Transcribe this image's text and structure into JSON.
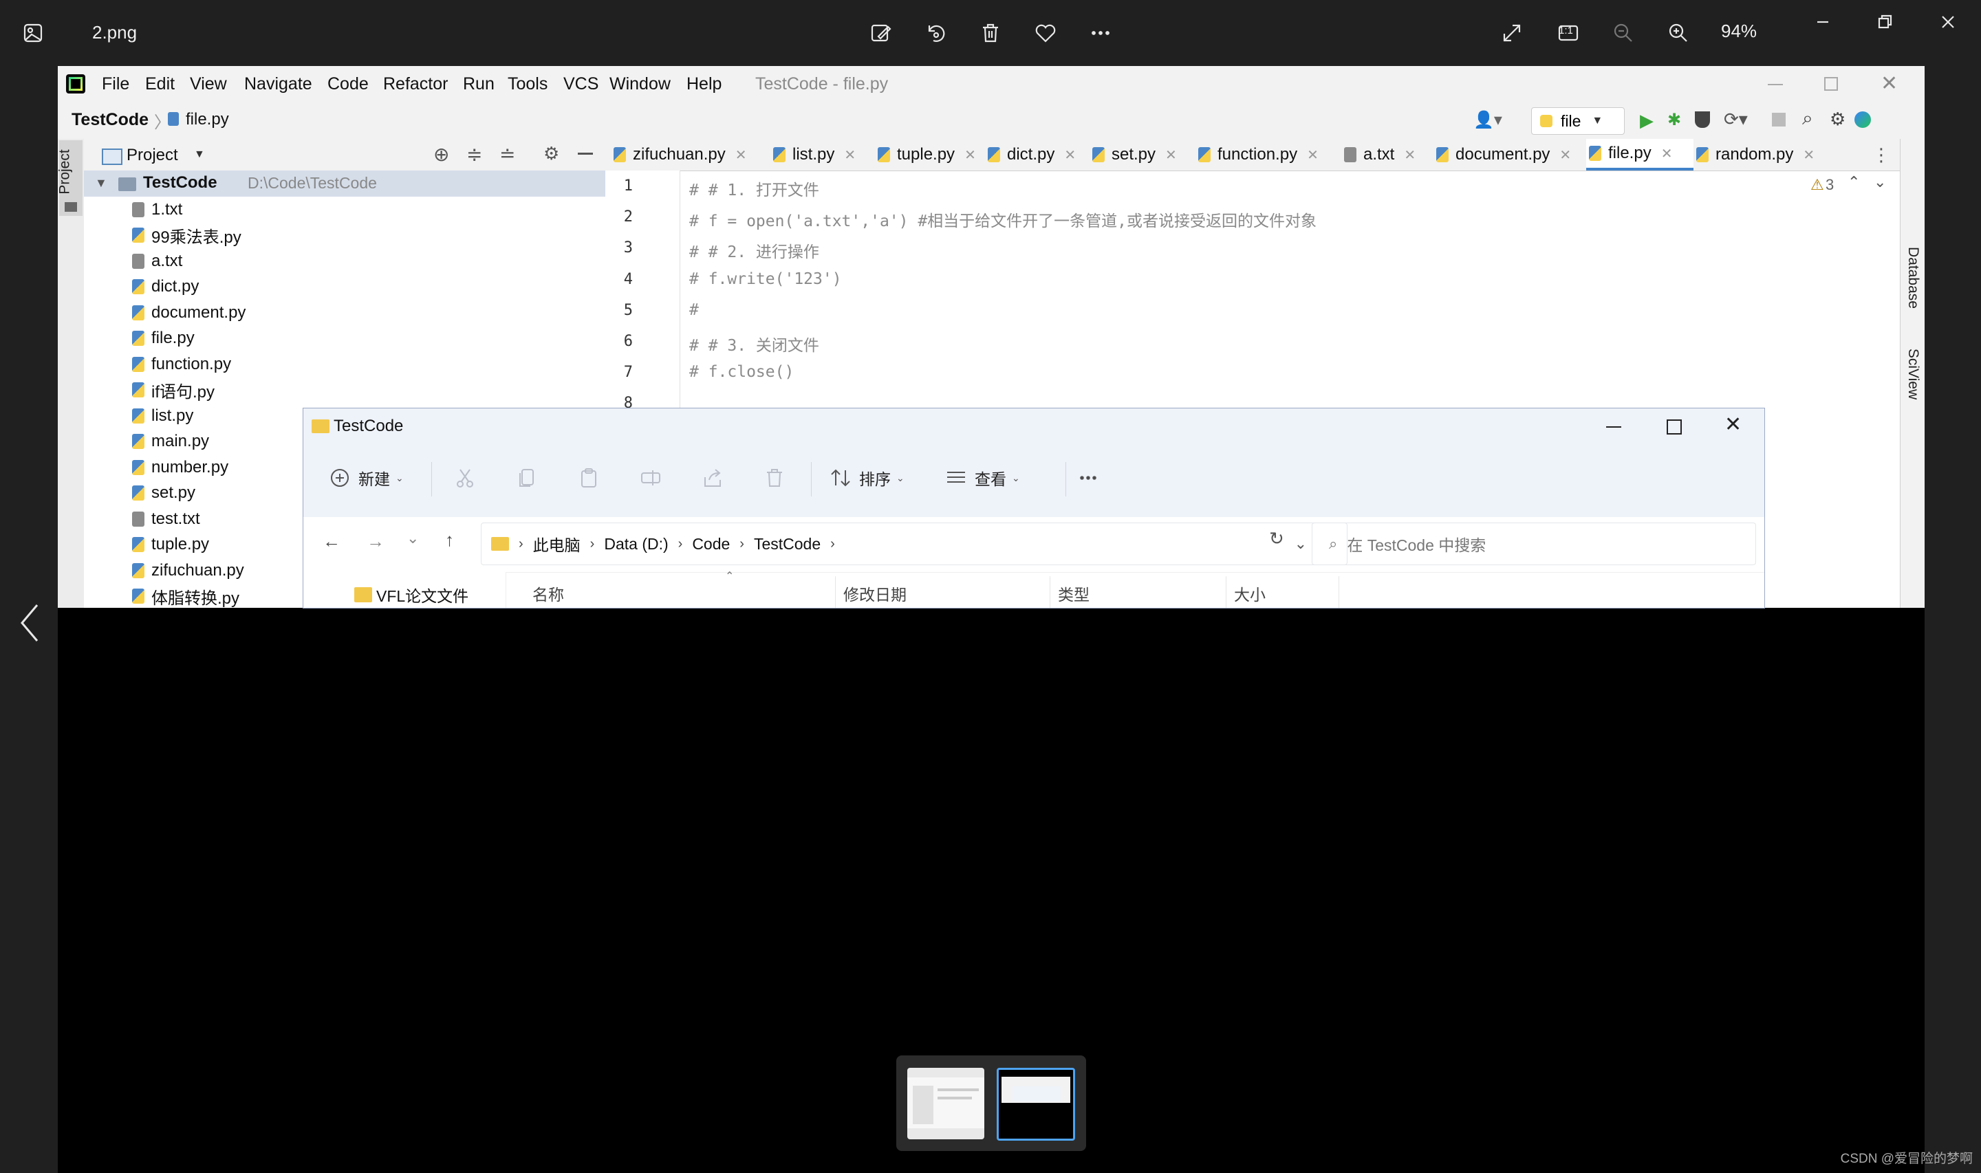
{
  "viewer": {
    "filename": "2.png",
    "zoom": "94%",
    "actual_size_label": "1:1",
    "icons": [
      "image-app-icon",
      "edit-image-icon",
      "rotate-icon",
      "delete-icon",
      "favorite-icon",
      "more-icon",
      "fullscreen-icon",
      "actual-size-icon",
      "zoom-out-icon",
      "zoom-in-icon",
      "minimize-icon",
      "restore-icon",
      "close-icon",
      "previous-icon"
    ]
  },
  "ide": {
    "window_title": "TestCode - file.py",
    "menu": [
      "File",
      "Edit",
      "View",
      "Navigate",
      "Code",
      "Refactor",
      "Run",
      "Tools",
      "VCS",
      "Window",
      "Help"
    ],
    "breadcrumb": {
      "project": "TestCode",
      "file": "file.py"
    },
    "run_config": "file",
    "side_left_label": "Project",
    "side_right_labels": [
      "Database",
      "SciView"
    ],
    "project_panel": {
      "title": "Project",
      "root_name": "TestCode",
      "root_path": "D:\\Code\\TestCode",
      "files": [
        "1.txt",
        "99乘法表.py",
        "a.txt",
        "dict.py",
        "document.py",
        "file.py",
        "function.py",
        "if语句.py",
        "list.py",
        "main.py",
        "number.py",
        "set.py",
        "test.txt",
        "tuple.py",
        "zifuchuan.py",
        "体脂转换.py"
      ]
    },
    "tabs": [
      "zifuchuan.py",
      "list.py",
      "tuple.py",
      "dict.py",
      "set.py",
      "function.py",
      "a.txt",
      "document.py",
      "file.py",
      "random.py"
    ],
    "active_tab": "file.py",
    "warning_count": "3",
    "code_lines": [
      {
        "n": "1",
        "text": "# # 1. 打开文件"
      },
      {
        "n": "2",
        "text": "# f = open('a.txt','a') #相当于给文件开了一条管道,或者说接受返回的文件对象"
      },
      {
        "n": "3",
        "text": "# # 2. 进行操作"
      },
      {
        "n": "4",
        "text": "# f.write('123')"
      },
      {
        "n": "5",
        "text": "#"
      },
      {
        "n": "6",
        "text": "# # 3. 关闭文件"
      },
      {
        "n": "7",
        "text": "# f.close()"
      },
      {
        "n": "8",
        "text": ""
      }
    ]
  },
  "explorer": {
    "title": "TestCode",
    "toolbar": {
      "new": "新建",
      "sort": "排序",
      "view": "查看"
    },
    "address": [
      "此电脑",
      "Data (D:)",
      "Code",
      "TestCode"
    ],
    "search_placeholder": "在 TestCode 中搜索",
    "nav_item": "VFL论文文件",
    "columns": [
      "名称",
      "修改日期",
      "类型",
      "大小"
    ]
  },
  "watermark": "CSDN @爱冒险的梦啊"
}
